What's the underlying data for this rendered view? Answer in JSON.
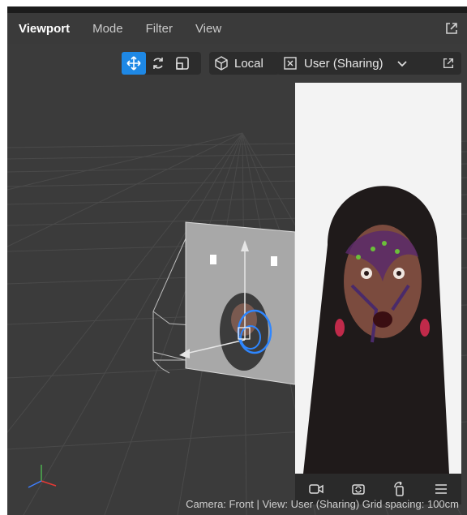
{
  "header": {
    "tabs": [
      {
        "label": "Viewport"
      },
      {
        "label": "Mode"
      },
      {
        "label": "Filter"
      },
      {
        "label": "View"
      }
    ]
  },
  "toolbar": {
    "space_label": "Local",
    "camera_label": "User (Sharing)"
  },
  "status": {
    "text": "Camera: Front | View: User (Sharing)  Grid spacing: 100cm"
  },
  "colors": {
    "accent": "#1e88e5",
    "gizmo_blue": "#2e86ff"
  }
}
